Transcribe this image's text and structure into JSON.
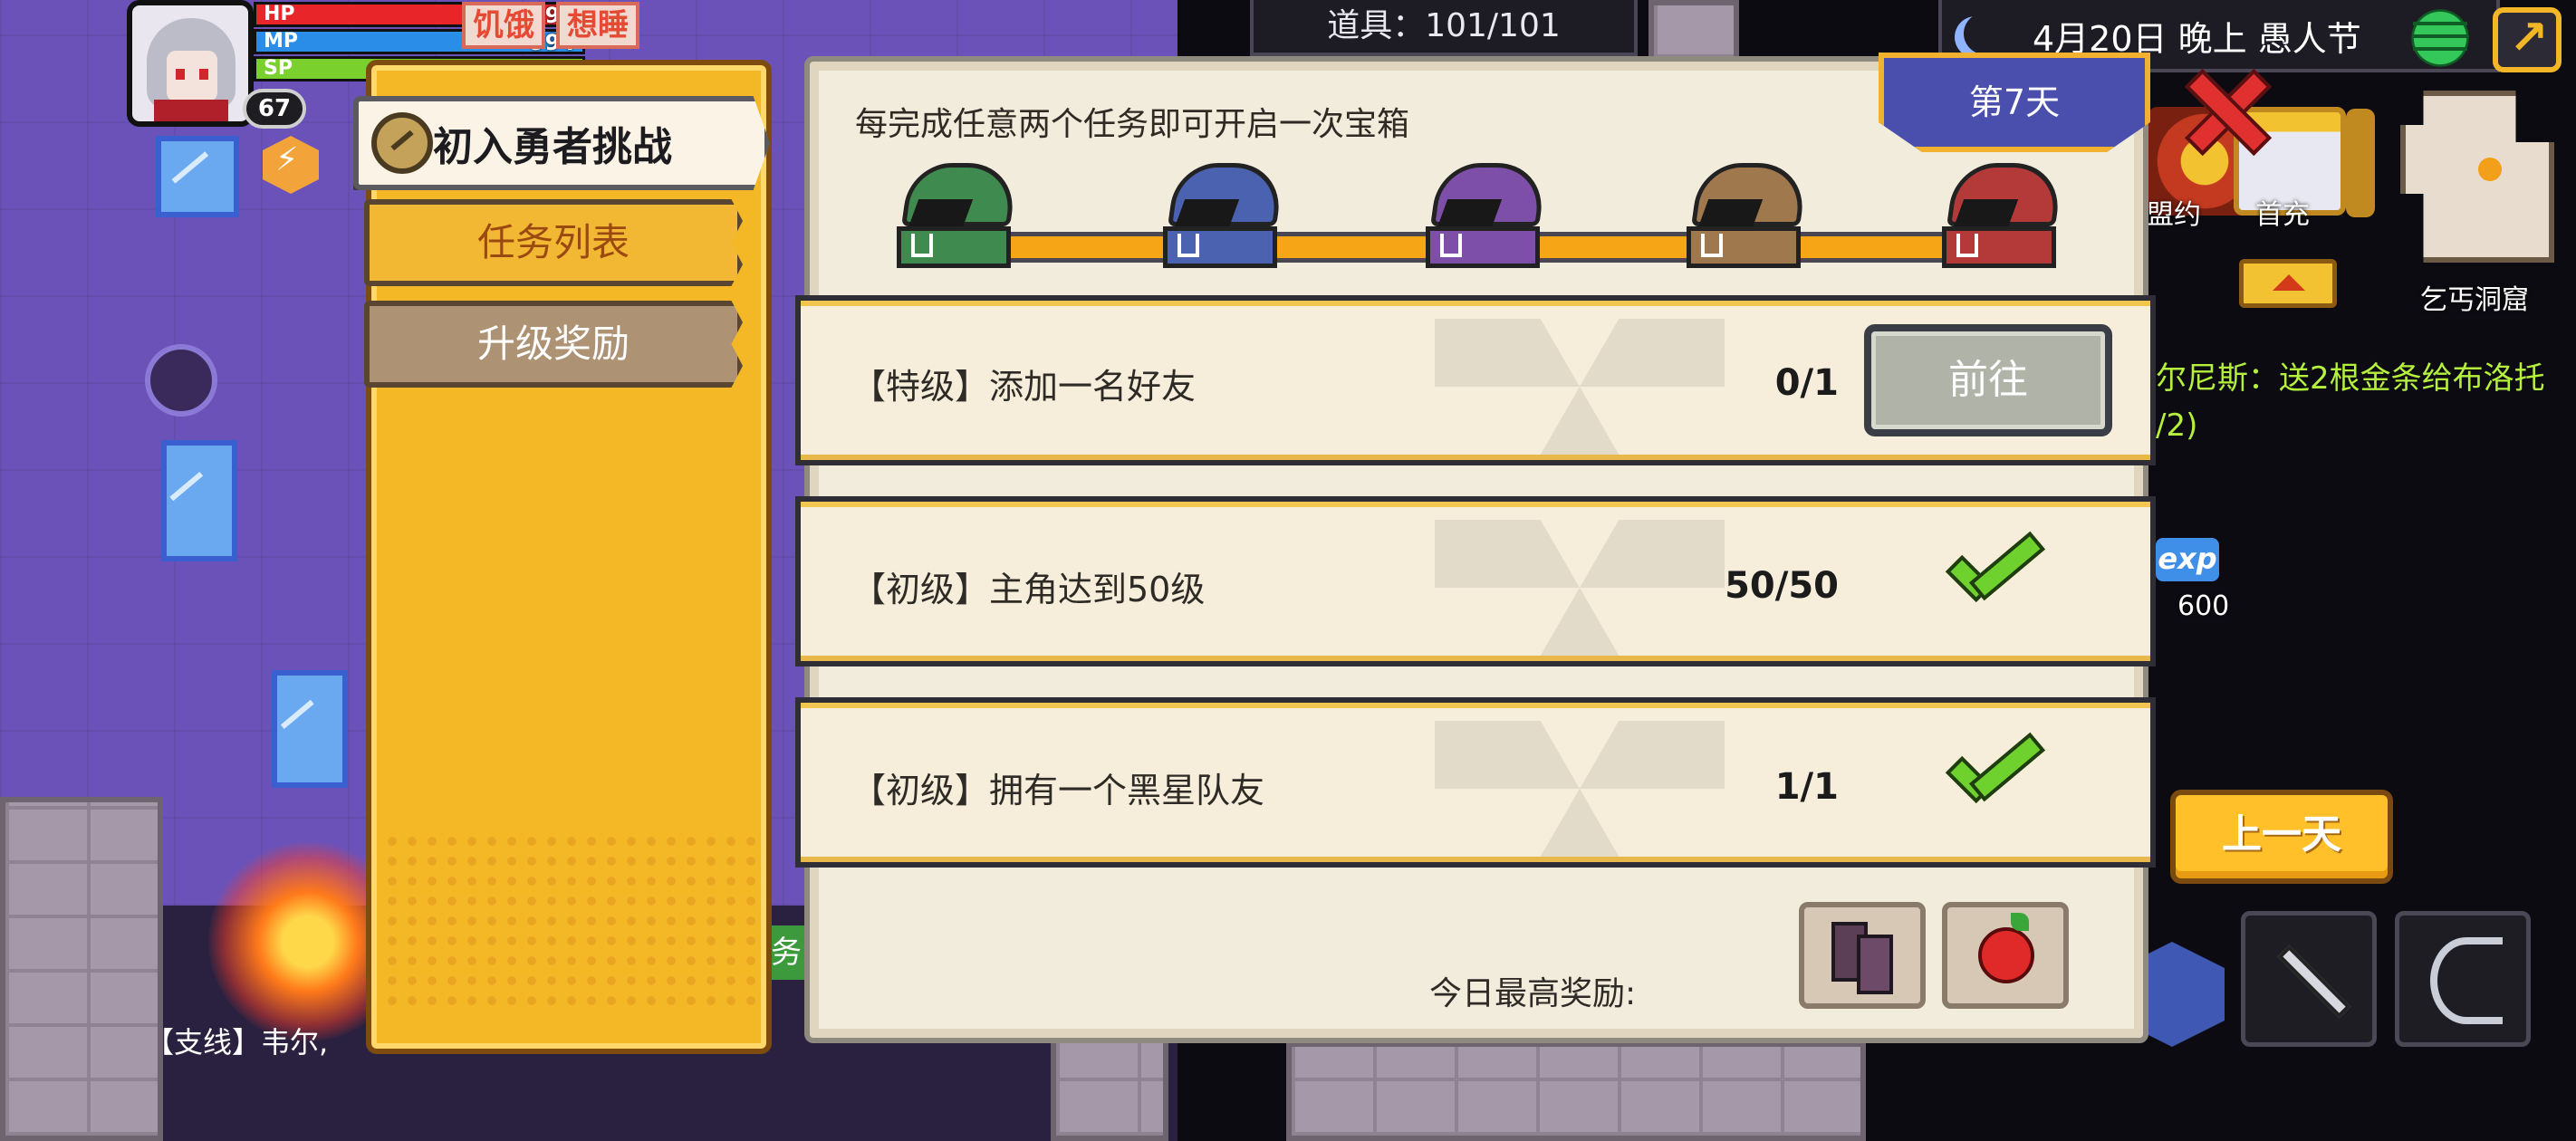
{
  "player": {
    "level": "67",
    "hp_label": "HP",
    "hp_value": "2698",
    "mp_label": "MP",
    "mp_value": "994",
    "sp_label": "SP",
    "status_effects": [
      "饥饿",
      "想睡"
    ]
  },
  "topbar": {
    "items": "道具：101/101",
    "datetime": "4月20日  晚上  愚人节"
  },
  "menu": {
    "challenge_title": "初入勇者挑战",
    "tabs": [
      "任务列表",
      "升级奖励"
    ],
    "active_tab": "任务列表"
  },
  "task_panel": {
    "hint": "每完成任意两个任务即可开启一次宝箱",
    "day": "第7天",
    "chests": [
      {
        "color": "#3f8a4f"
      },
      {
        "color": "#4a62b0"
      },
      {
        "color": "#7e4fa8"
      },
      {
        "color": "#a0784e"
      },
      {
        "color": "#b43a3a"
      }
    ],
    "tasks": [
      {
        "name": "【特级】添加一名好友",
        "progress": "0/1",
        "action": "前往",
        "done": false
      },
      {
        "name": "【初级】主角达到50级",
        "progress": "50/50",
        "done": true
      },
      {
        "name": "【初级】拥有一个黑星队友",
        "progress": "1/1",
        "done": true
      }
    ],
    "reward_label": "今日最高奖励:",
    "rewards": [
      "boots-icon",
      "apple-icon"
    ]
  },
  "side": {
    "minimap_label": "乞丐洞窟",
    "quest_text": "尔尼斯：送2根金条给布洛托 /2)",
    "exp_label": "exp",
    "exp_value": "600",
    "icon_labels": [
      "盟约",
      "首充"
    ],
    "prev_day": "上一天",
    "subquest": "【支线】韦尔,"
  },
  "colors": {
    "accent": "#f4b827",
    "panel_bg": "#f2ecdc",
    "done_green": "#6fd12e",
    "quest_green": "#b4f03c"
  }
}
